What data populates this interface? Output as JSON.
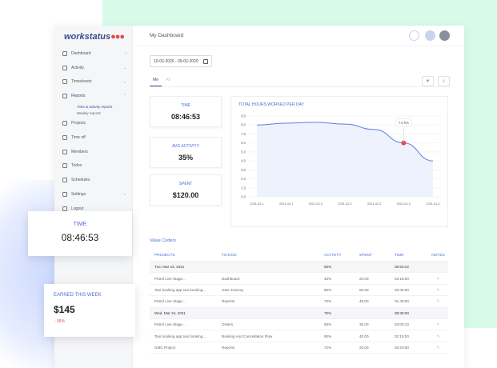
{
  "brand": {
    "logo_text": "workstatus",
    "logo_dots": "●●●",
    "accent": "#3b4a8c",
    "red": "#e34b4b",
    "blue": "#4a6ed8"
  },
  "header": {
    "title": "My Dashboard"
  },
  "sidebar": {
    "items": [
      {
        "label": "Dashboard",
        "icon": "home-icon"
      },
      {
        "label": "Activity",
        "icon": "activity-icon"
      },
      {
        "label": "Timesheets",
        "icon": "clock-icon"
      },
      {
        "label": "Reports",
        "icon": "chart-icon"
      },
      {
        "label": "Projects",
        "icon": "folder-icon"
      },
      {
        "label": "Time off",
        "icon": "calendar-icon"
      },
      {
        "label": "Members",
        "icon": "users-icon"
      },
      {
        "label": "Todos",
        "icon": "checklist-icon"
      },
      {
        "label": "Schedules",
        "icon": "schedule-icon"
      },
      {
        "label": "Settings",
        "icon": "gear-icon"
      },
      {
        "label": "Logout",
        "icon": "logout-icon"
      }
    ],
    "reports_sub": [
      "Time & activity reports",
      "Weekly reports"
    ]
  },
  "filters": {
    "date_range": "10-02-2020 - 09-02-2020",
    "tabs": [
      "Me",
      "All"
    ]
  },
  "stats": [
    {
      "label": "TIME",
      "value": "08:46:53"
    },
    {
      "label": "AVG ACTIVITY",
      "value": "35%"
    },
    {
      "label": "SPENT",
      "value": "$120.00"
    }
  ],
  "chart_data": {
    "type": "line",
    "title": "TOTAL HOURS WORKED PER DAY",
    "x": [
      "2021-02-1",
      "2021-03-1",
      "2021-02-2",
      "2021-02-2",
      "2021-02-2",
      "2021-01-2",
      "2021-01-2"
    ],
    "series": [
      {
        "values": [
          8.0,
          8.2,
          8.3,
          8.1,
          7.5,
          6.0,
          4.0
        ]
      }
    ],
    "ylim": [
      0,
      9
    ],
    "yticks": [
      "0.0",
      "1.0",
      "2.0",
      "3.0",
      "4.0",
      "5.0",
      "6.0",
      "7.0",
      "8.0",
      "9.0"
    ],
    "tooltip": "7.5 hrs",
    "xlabel": "",
    "ylabel": ""
  },
  "table": {
    "title": "Value Coders",
    "headers": [
      "PROJECTS",
      "TO-DOS",
      "ACTIVITY",
      "SPENT",
      "TIME",
      "NOTES"
    ],
    "rows": [
      {
        "group": true,
        "project": "Tue, Mar 23, 2021",
        "todo": "",
        "activity": "65%",
        "spent": "",
        "time": "08:53:22"
      },
      {
        "group": false,
        "project": "Petrol Live Stage...",
        "todo": "Dashboard",
        "activity": "45%",
        "spent": "20.00",
        "time": "03:18:00"
      },
      {
        "group": false,
        "project": "Taxi booking app taxi booking...",
        "todo": "User Journey",
        "activity": "86%",
        "spent": "55.00",
        "time": "03:46:00"
      },
      {
        "group": false,
        "project": "Petrol Live Stage...",
        "todo": "Reports",
        "activity": "70%",
        "spent": "45.00",
        "time": "01:49:00"
      },
      {
        "group": true,
        "project": "Wed, Mar 24, 2021",
        "todo": "",
        "activity": "75%",
        "spent": "",
        "time": "08:35:00"
      },
      {
        "group": false,
        "project": "Petrol Live Stage...",
        "todo": "Orders",
        "activity": "55%",
        "spent": "35.00",
        "time": "03:00:10"
      },
      {
        "group": false,
        "project": "Taxi booking app taxi booking...",
        "todo": "Booking And Cancellation Flow",
        "activity": "80%",
        "spent": "40.00",
        "time": "02:15:00"
      },
      {
        "group": false,
        "project": "GMC Project",
        "todo": "Reports",
        "activity": "72%",
        "spent": "20.00",
        "time": "03:20:00"
      }
    ]
  },
  "float_time": {
    "label": "TIME",
    "value": "08:46:53"
  },
  "float_earned": {
    "label": "EARNED THIS WEEK",
    "value": "$145",
    "change": "↓ 05%"
  }
}
